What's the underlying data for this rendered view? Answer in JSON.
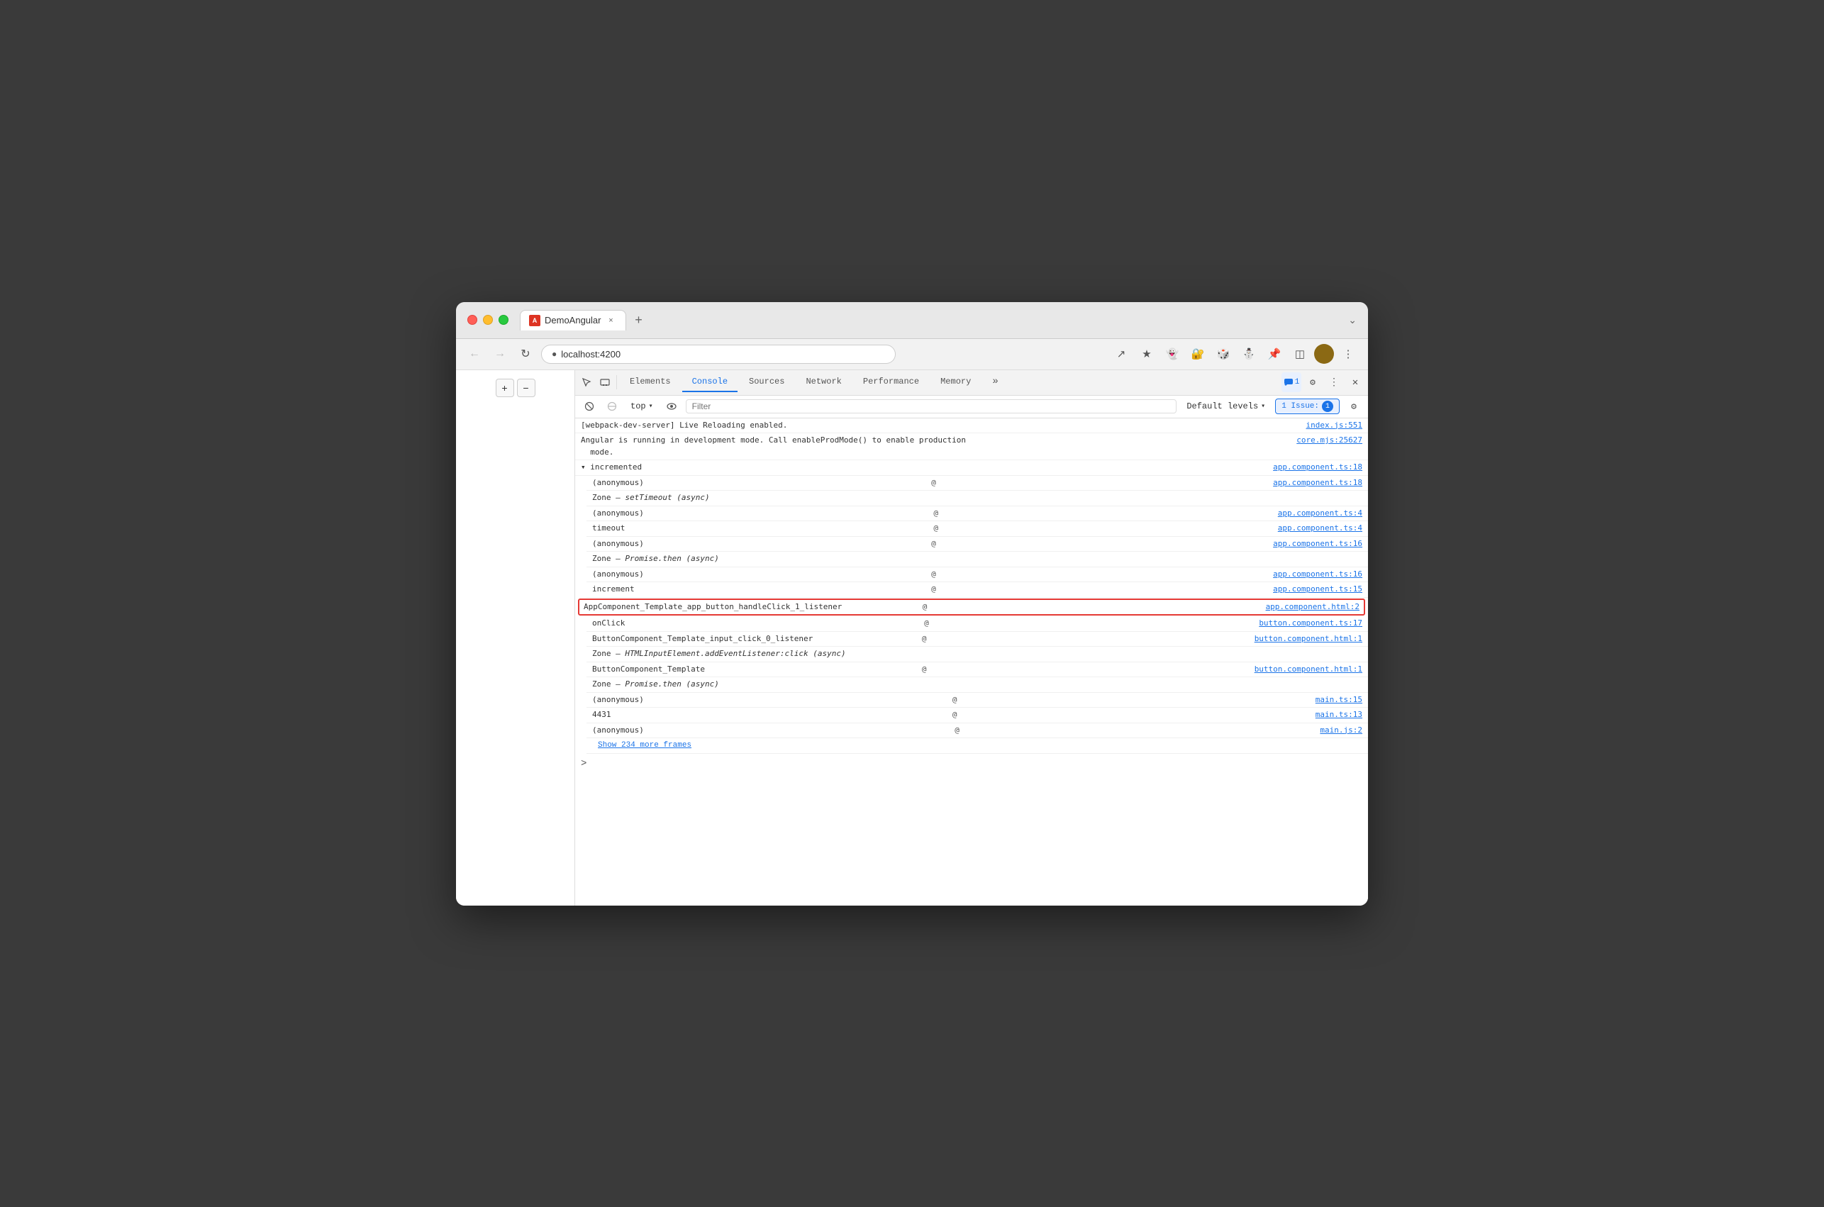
{
  "browser": {
    "tab_title": "DemoAngular",
    "tab_close": "×",
    "tab_add": "+",
    "address": "localhost:4200",
    "chevron_down": "⌄"
  },
  "devtools": {
    "tabs": [
      "Elements",
      "Console",
      "Sources",
      "Network",
      "Performance",
      "Memory"
    ],
    "active_tab": "Console",
    "more_tabs": "»",
    "issue_label": "1 Issue:",
    "issue_count": "1",
    "sub_toolbar": {
      "top_label": "top",
      "filter_placeholder": "Filter",
      "default_levels": "Default levels",
      "chevron": "▾"
    }
  },
  "console": {
    "lines": [
      {
        "id": 1,
        "text": "[webpack-dev-server] Live Reloading enabled.",
        "link": "index.js:551",
        "indent": false,
        "highlighted": false
      },
      {
        "id": 2,
        "text": "Angular is running in development mode. Call enableProdMode() to enable production mode.",
        "link": "core.mjs:25627",
        "indent": false,
        "highlighted": false
      },
      {
        "id": 3,
        "text": "▾ incremented",
        "link": "app.component.ts:18",
        "indent": false,
        "highlighted": false
      },
      {
        "id": 4,
        "text": "(anonymous)",
        "link": "app.component.ts:18",
        "indent": true,
        "highlighted": false,
        "link_prefix": "@ "
      },
      {
        "id": 5,
        "text": "Zone — setTimeout (async)",
        "link": "",
        "indent": true,
        "highlighted": false
      },
      {
        "id": 6,
        "text": "(anonymous)",
        "link": "app.component.ts:4",
        "indent": true,
        "highlighted": false,
        "link_prefix": "@ "
      },
      {
        "id": 7,
        "text": "timeout",
        "link": "app.component.ts:4",
        "indent": true,
        "highlighted": false,
        "link_prefix": "@ "
      },
      {
        "id": 8,
        "text": "(anonymous)",
        "link": "app.component.ts:16",
        "indent": true,
        "highlighted": false,
        "link_prefix": "@ "
      },
      {
        "id": 9,
        "text": "Zone — Promise.then (async)",
        "link": "",
        "indent": true,
        "highlighted": false
      },
      {
        "id": 10,
        "text": "(anonymous)",
        "link": "app.component.ts:16",
        "indent": true,
        "highlighted": false,
        "link_prefix": "@ "
      },
      {
        "id": 11,
        "text": "increment",
        "link": "app.component.ts:15",
        "indent": true,
        "highlighted": false,
        "link_prefix": "@ "
      },
      {
        "id": 12,
        "text": "AppComponent_Template_app_button_handleClick_1_listener",
        "link": "app.component.html:2",
        "indent": true,
        "highlighted": true,
        "link_prefix": "@ "
      },
      {
        "id": 13,
        "text": "onClick",
        "link": "button.component.ts:17",
        "indent": true,
        "highlighted": false,
        "link_prefix": "@ "
      },
      {
        "id": 14,
        "text": "ButtonComponent_Template_input_click_0_listener",
        "link": "button.component.html:1",
        "indent": true,
        "highlighted": false,
        "link_prefix": "@ "
      },
      {
        "id": 15,
        "text": "Zone — HTMLInputElement.addEventListener:click (async)",
        "link": "",
        "indent": true,
        "highlighted": false
      },
      {
        "id": 16,
        "text": "ButtonComponent_Template",
        "link": "button.component.html:1",
        "indent": true,
        "highlighted": false,
        "link_prefix": "@ "
      },
      {
        "id": 17,
        "text": "Zone — Promise.then (async)",
        "link": "",
        "indent": true,
        "highlighted": false
      },
      {
        "id": 18,
        "text": "(anonymous)",
        "link": "main.ts:15",
        "indent": true,
        "highlighted": false,
        "link_prefix": "@ "
      },
      {
        "id": 19,
        "text": "4431",
        "link": "main.ts:13",
        "indent": true,
        "highlighted": false,
        "link_prefix": "@ "
      },
      {
        "id": 20,
        "text": "(anonymous)",
        "link": "main.js:2",
        "indent": true,
        "highlighted": false,
        "link_prefix": "@ "
      }
    ],
    "show_more": "Show 234 more frames",
    "prompt_arrow": ">"
  },
  "page_controls": {
    "plus": "+",
    "minus": "−"
  }
}
